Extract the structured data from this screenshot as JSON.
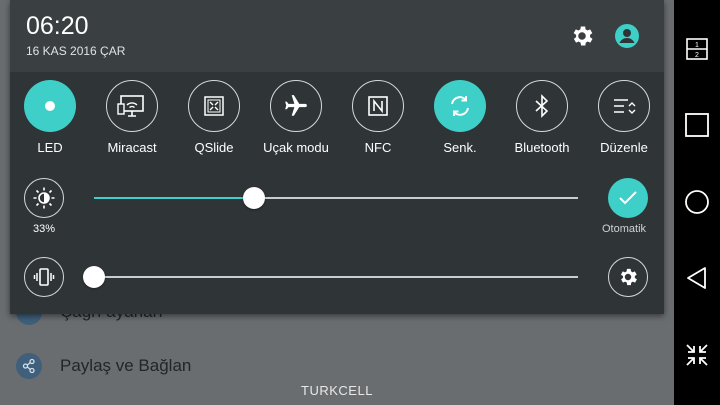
{
  "status": {
    "time": "06:20",
    "date": "16 KAS 2016 ÇAR"
  },
  "header_icons": [
    "gear-icon",
    "user-icon"
  ],
  "quick_settings": [
    {
      "label": "LED",
      "active": true,
      "icon": "led-icon"
    },
    {
      "label": "Miracast",
      "active": false,
      "icon": "miracast-icon"
    },
    {
      "label": "QSlide",
      "active": false,
      "icon": "qslide-icon"
    },
    {
      "label": "Uçak modu",
      "active": false,
      "icon": "airplane-icon"
    },
    {
      "label": "NFC",
      "active": false,
      "icon": "nfc-icon"
    },
    {
      "label": "Senk.",
      "active": true,
      "icon": "sync-icon"
    },
    {
      "label": "Bluetooth",
      "active": false,
      "icon": "bluetooth-icon"
    },
    {
      "label": "Düzenle",
      "active": false,
      "icon": "edit-icon"
    }
  ],
  "brightness": {
    "percent_label": "33%",
    "value": 0.33,
    "auto_label": "Otomatik"
  },
  "volume": {
    "value": 0.0
  },
  "background_list": [
    {
      "label": "Çağrı ayarları",
      "icon": "phone-icon"
    },
    {
      "label": "Paylaş ve Bağlan",
      "icon": "share-icon"
    }
  ],
  "carrier": "TURKCELL",
  "colors": {
    "accent": "#3ed0c8",
    "panel": "#2f3437",
    "header": "#3a3f42"
  }
}
